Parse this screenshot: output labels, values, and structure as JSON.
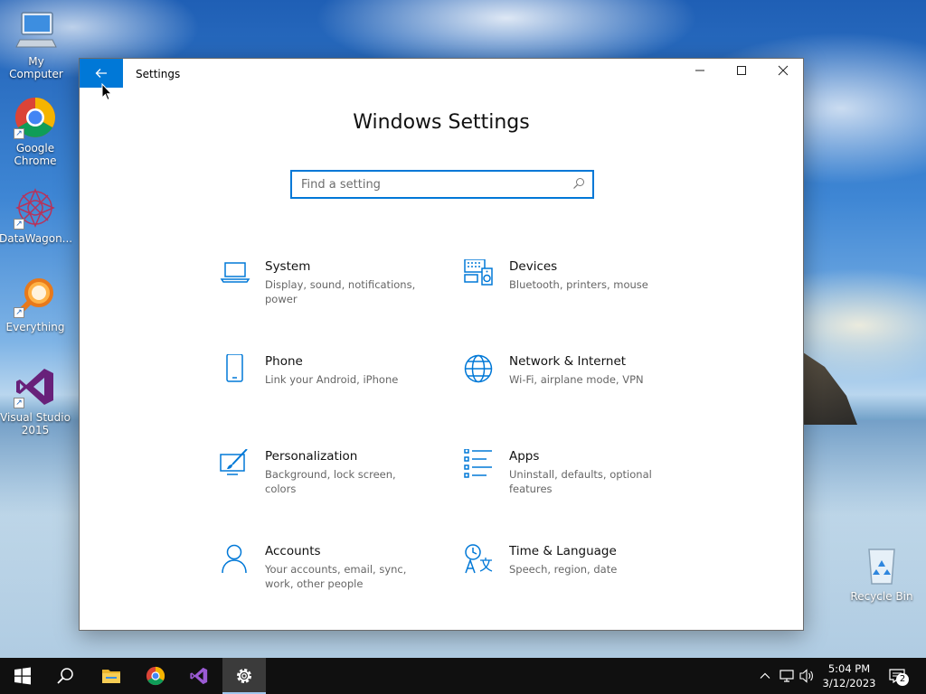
{
  "desktop": {
    "icons": [
      {
        "label": "My Computer",
        "icon": "computer-icon"
      },
      {
        "label": "Google Chrome",
        "icon": "chrome-icon"
      },
      {
        "label": "DataWagon...",
        "icon": "datawagon-icon"
      },
      {
        "label": "Everything",
        "icon": "search-magnifier-icon"
      },
      {
        "label": "Visual Studio 2015",
        "icon": "visual-studio-icon"
      },
      {
        "label": "Recycle Bin",
        "icon": "recycle-bin-icon"
      }
    ]
  },
  "window": {
    "title": "Settings",
    "back_icon": "arrow-left-icon",
    "heading": "Windows Settings",
    "search": {
      "placeholder": "Find a setting",
      "value": ""
    },
    "accent_color": "#0078d7",
    "categories": [
      {
        "name": "System",
        "description": "Display, sound, notifications, power",
        "icon": "laptop-icon"
      },
      {
        "name": "Devices",
        "description": "Bluetooth, printers, mouse",
        "icon": "keyboard-speaker-icon"
      },
      {
        "name": "Phone",
        "description": "Link your Android, iPhone",
        "icon": "phone-icon"
      },
      {
        "name": "Network & Internet",
        "description": "Wi-Fi, airplane mode, VPN",
        "icon": "globe-icon"
      },
      {
        "name": "Personalization",
        "description": "Background, lock screen, colors",
        "icon": "paint-brush-icon"
      },
      {
        "name": "Apps",
        "description": "Uninstall, defaults, optional features",
        "icon": "apps-list-icon"
      },
      {
        "name": "Accounts",
        "description": "Your accounts, email, sync, work, other people",
        "icon": "person-icon"
      },
      {
        "name": "Time & Language",
        "description": "Speech, region, date",
        "icon": "time-language-icon"
      }
    ]
  },
  "taskbar": {
    "items": [
      {
        "name": "start",
        "icon": "windows-logo-icon"
      },
      {
        "name": "search",
        "icon": "search-icon"
      },
      {
        "name": "file-explorer",
        "icon": "folder-icon"
      },
      {
        "name": "chrome",
        "icon": "chrome-icon"
      },
      {
        "name": "visual-studio",
        "icon": "visual-studio-icon"
      },
      {
        "name": "settings",
        "icon": "gear-icon",
        "active": true
      }
    ],
    "clock": {
      "time": "5:04 PM",
      "date": "3/12/2023"
    },
    "notification_count": "2"
  }
}
